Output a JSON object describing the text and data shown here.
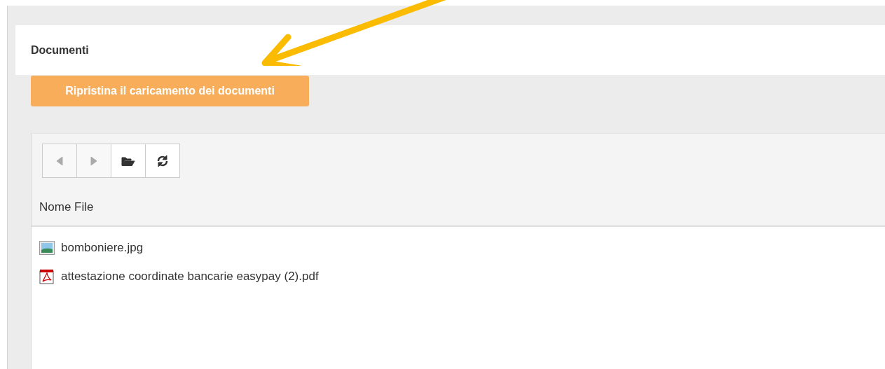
{
  "panel": {
    "title": "Documenti"
  },
  "restore_button": {
    "label": "Ripristina il caricamento dei documenti"
  },
  "toolbar": [
    {
      "kind": "back",
      "disabled": true
    },
    {
      "kind": "forward",
      "disabled": true
    },
    {
      "kind": "open-folder",
      "disabled": false
    },
    {
      "kind": "refresh",
      "disabled": false
    }
  ],
  "table": {
    "columns": [
      "Nome File"
    ],
    "rows": [
      {
        "kind": "image",
        "name": "bomboniere.jpg"
      },
      {
        "kind": "pdf",
        "name": "attestazione coordinate bancarie easypay (2).pdf"
      }
    ]
  }
}
